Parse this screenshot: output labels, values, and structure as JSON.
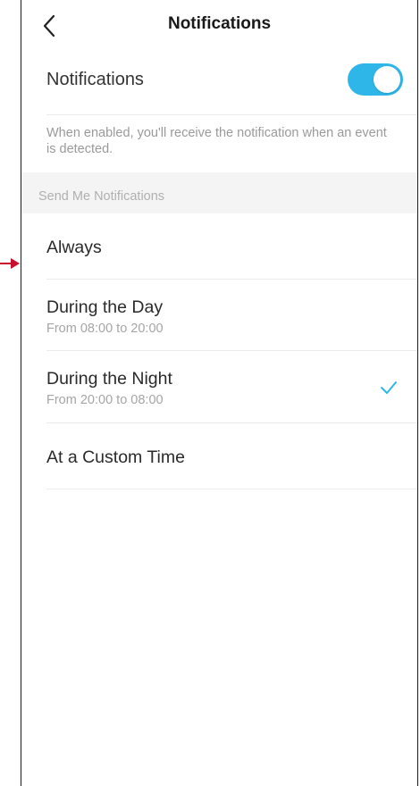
{
  "header": {
    "title": "Notifications",
    "back_icon": "chevron-left-icon"
  },
  "notifications_toggle": {
    "label": "Notifications",
    "enabled": true,
    "accent_color": "#2fb6e8",
    "description": "When enabled, you'll receive the notification when an event is detected."
  },
  "section": {
    "title": "Send Me Notifications"
  },
  "options": [
    {
      "title": "Always",
      "subtitle": "",
      "selected": false
    },
    {
      "title": "During the Day",
      "subtitle": "From 08:00 to 20:00",
      "selected": false
    },
    {
      "title": "During the Night",
      "subtitle": "From 20:00 to 08:00",
      "selected": true
    },
    {
      "title": "At a Custom Time",
      "subtitle": "",
      "selected": false
    }
  ],
  "annotation": {
    "arrow_color": "#c8102e"
  }
}
